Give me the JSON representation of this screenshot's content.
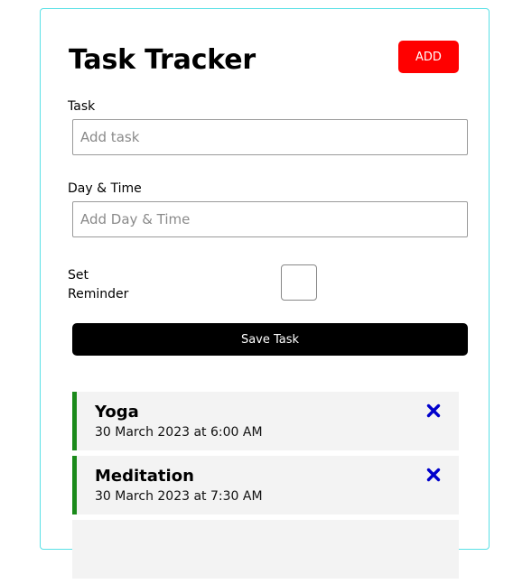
{
  "header": {
    "title": "Task Tracker",
    "add_label": "ADD"
  },
  "form": {
    "task_label": "Task",
    "task_placeholder": "Add task",
    "task_value": "",
    "day_label": "Day & Time",
    "day_placeholder": "Add Day & Time",
    "day_value": "",
    "reminder_label_line1": "Set",
    "reminder_label_line2": "Reminder",
    "reminder_checked": false,
    "save_label": "Save Task"
  },
  "tasks": [
    {
      "name": "Yoga",
      "time": "30 March 2023 at 6:00 AM",
      "reminder": true
    },
    {
      "name": "Meditation",
      "time": "30 March 2023 at 7:30 AM",
      "reminder": true
    }
  ],
  "icons": {
    "delete": "close-icon"
  },
  "colors": {
    "card_border": "#59e0e6",
    "add_button": "#ff0000",
    "save_button": "#000000",
    "reminder_accent": "#1a8a1a",
    "delete_icon": "#0000cc",
    "task_bg": "#f3f3f3"
  }
}
